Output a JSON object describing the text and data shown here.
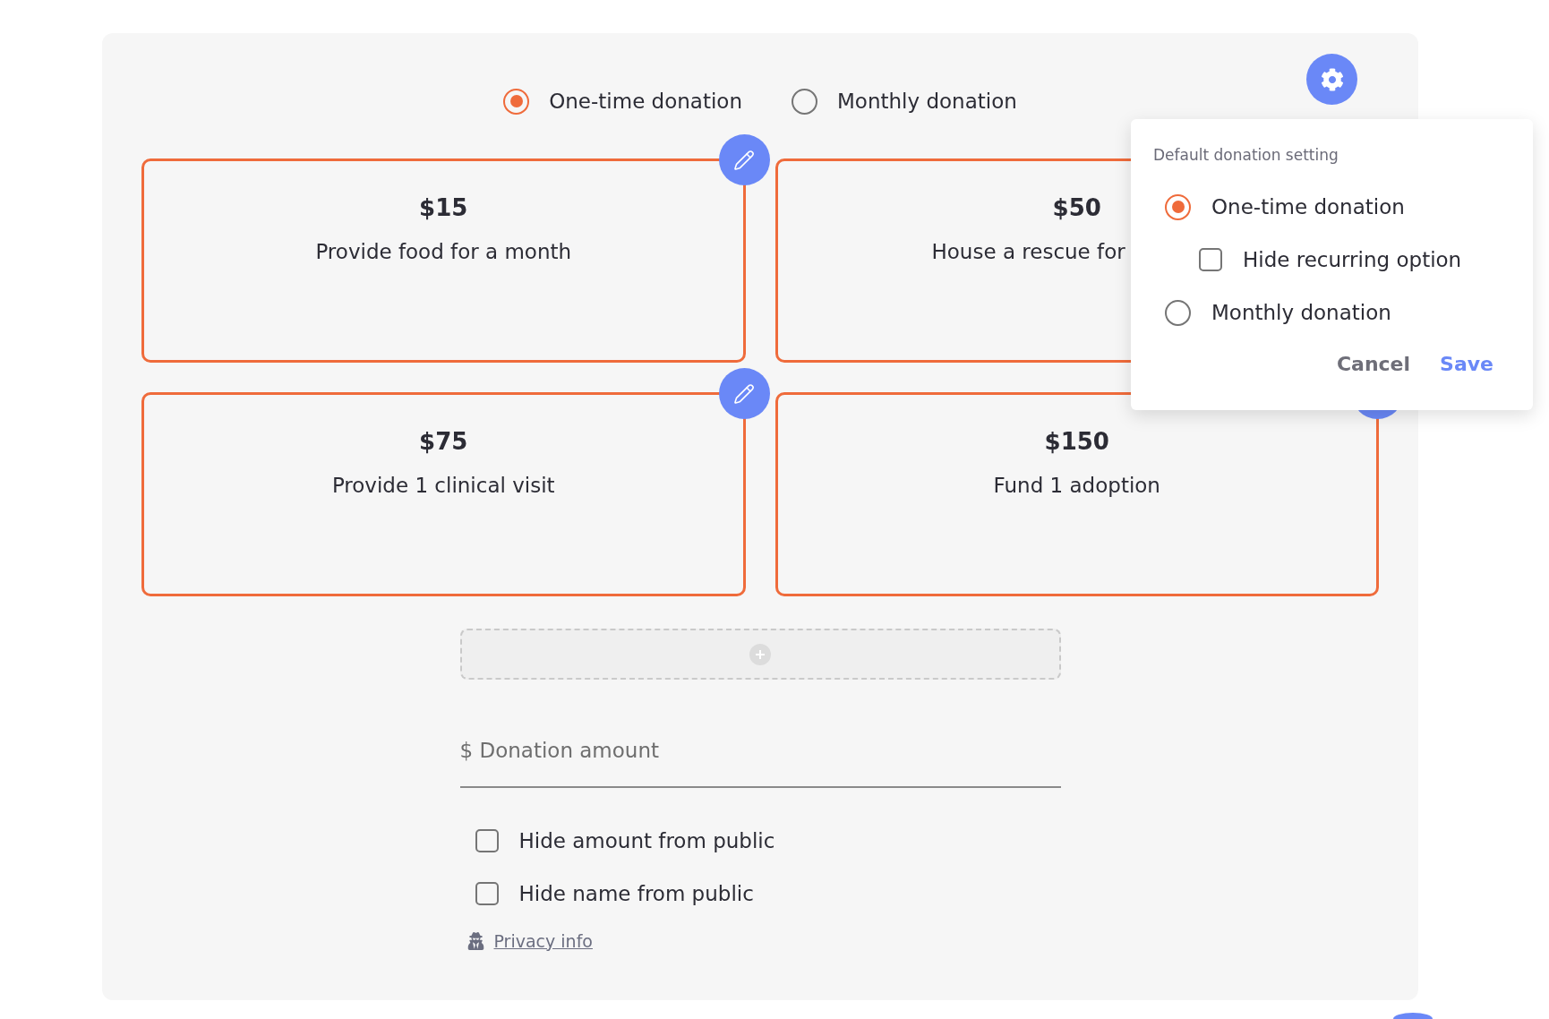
{
  "donation_type": [
    {
      "label": "One-time donation",
      "selected": true
    },
    {
      "label": "Monthly donation",
      "selected": false
    }
  ],
  "amount_cards": [
    {
      "amount": "$15",
      "description": "Provide food for a month"
    },
    {
      "amount": "$50",
      "description": "House a rescue for"
    },
    {
      "amount": "$75",
      "description": "Provide 1 clinical visit"
    },
    {
      "amount": "$150",
      "description": "Fund 1 adoption"
    }
  ],
  "donation_amount": {
    "placeholder": "$ Donation amount"
  },
  "privacy_options": [
    {
      "label": "Hide amount from public",
      "checked": false
    },
    {
      "label": "Hide name from public",
      "checked": false
    }
  ],
  "privacy_link": {
    "label": "Privacy info"
  },
  "settings_popover": {
    "title": "Default donation setting",
    "options": [
      {
        "label": "One-time donation",
        "selected": true,
        "children": [
          {
            "label": "Hide recurring option",
            "checked": false
          }
        ]
      },
      {
        "label": "Monthly donation",
        "selected": false
      }
    ],
    "buttons": [
      {
        "label": "Cancel",
        "kind": "secondary"
      },
      {
        "label": "Save",
        "kind": "primary"
      }
    ]
  }
}
